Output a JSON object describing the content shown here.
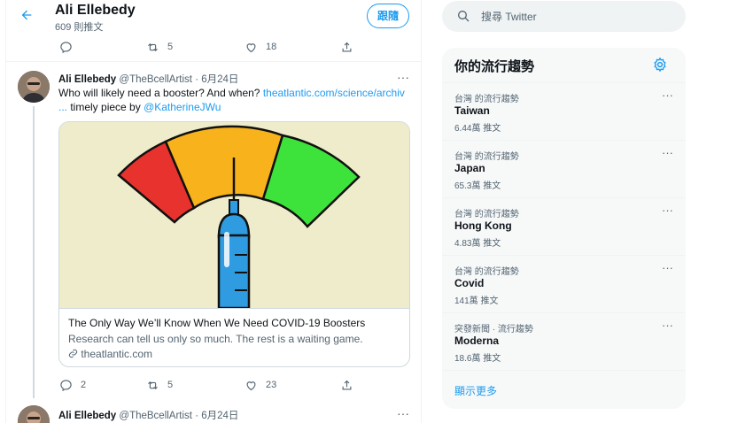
{
  "header": {
    "back_icon": "arrow-left-icon",
    "name": "Ali Ellebedy",
    "tweet_count": "609 則推文",
    "follow_label": "跟隨"
  },
  "prev_tweet_actions": {
    "reply": "",
    "retweet": "5",
    "like": "18"
  },
  "tweet": {
    "name": "Ali Ellebedy",
    "handle": "@TheBcellArtist",
    "sep": " · ",
    "date": "6月24日",
    "more": "···",
    "text_1": "Who will likely need a booster? And when? ",
    "link": "theatlantic.com/science/archiv",
    "link_cont": "...",
    "text_2": " timely piece by ",
    "mention": "@KatherineJWu",
    "card": {
      "title": "The Only Way We’ll Know When We Need COVID-19 Boosters",
      "description": "Research can tell us only so much. The rest is a waiting game.",
      "domain": "theatlantic.com"
    },
    "actions": {
      "reply": "2",
      "retweet": "5",
      "like": "23"
    }
  },
  "next_tweet": {
    "name": "Ali Ellebedy",
    "handle": "@TheBcellArtist",
    "sep": " · ",
    "date": "6月24日",
    "more": "···"
  },
  "search": {
    "placeholder": "搜尋 Twitter"
  },
  "trends": {
    "title": "你的流行趨勢",
    "items": [
      {
        "context": "台灣 的流行趨勢",
        "name": "Taiwan",
        "count": "6.44萬 推文"
      },
      {
        "context": "台灣 的流行趨勢",
        "name": "Japan",
        "count": "65.3萬 推文"
      },
      {
        "context": "台灣 的流行趨勢",
        "name": "Hong Kong",
        "count": "4.83萬 推文"
      },
      {
        "context": "台灣 的流行趨勢",
        "name": "Covid",
        "count": "141萬 推文"
      },
      {
        "context": "突發新聞 · 流行趨勢",
        "name": "Moderna",
        "count": "18.6萬 推文"
      }
    ],
    "more_label": "···",
    "show_more": "顯示更多"
  },
  "colors": {
    "accent": "#1d9bf0",
    "text": "#0f1419",
    "muted": "#536471",
    "gauge_red": "#e8322e",
    "gauge_amber": "#f7b21c",
    "gauge_green": "#3de33a",
    "syringe_blue": "#2f9be0"
  }
}
